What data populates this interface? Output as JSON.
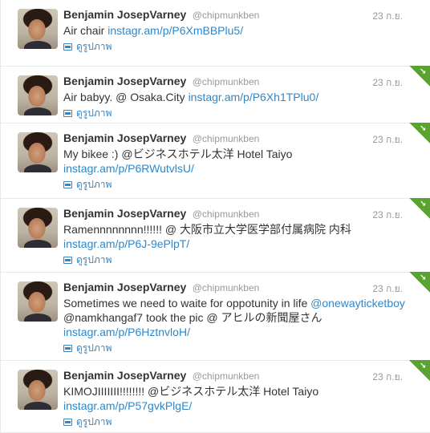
{
  "author": {
    "name": "Benjamin JosepVarney",
    "handle": "@chipmunkben"
  },
  "tweets": [
    {
      "date": "23 ก.ย.",
      "text_before": "Air chair ",
      "link1": "instagr.am/p/P6XmBBPlu5/",
      "text_after": "",
      "link2": "",
      "text_end": "",
      "view_label": "ดูรูปภาพ",
      "new": false
    },
    {
      "date": "23 ก.ย.",
      "text_before": "Air babyy. @ Osaka.City ",
      "link1": "instagr.am/p/P6Xh1TPlu0/",
      "text_after": "",
      "link2": "",
      "text_end": "",
      "view_label": "ดูรูปภาพ",
      "new": true
    },
    {
      "date": "23 ก.ย.",
      "text_before": "My bikee :) @ビジネスホテル太洋 Hotel Taiyo ",
      "link1": "instagr.am/p/P6RWutvlsU/",
      "text_after": "",
      "link2": "",
      "text_end": "",
      "view_label": "ดูรูปภาพ",
      "new": true
    },
    {
      "date": "23 ก.ย.",
      "text_before": "Ramennnnnnnn!!!!!! @ 大阪市立大学医学部付属病院 内科 ",
      "link1": "instagr.am/p/P6J-9ePlpT/",
      "text_after": "",
      "link2": "",
      "text_end": "",
      "view_label": "ดูรูปภาพ",
      "new": true
    },
    {
      "date": "23 ก.ย.",
      "text_before": "Sometimes we need to waite for oppotunity in life ",
      "link1": "@onewayticketboy",
      "text_after": " @namkhangaf7 took the pic @ アヒルの新聞屋さん ",
      "link2": "instagr.am/p/P6HztnvloH/",
      "text_end": "",
      "view_label": "ดูรูปภาพ",
      "new": true
    },
    {
      "date": "23 ก.ย.",
      "text_before": "KIMOJIIIIIII!!!!!!!! @ビジネスホテル太洋 Hotel Taiyo ",
      "link1": "instagr.am/p/P57gvkPlgE/",
      "text_after": "",
      "link2": "",
      "text_end": "",
      "view_label": "ดูรูปภาพ",
      "new": true
    }
  ],
  "colors": {
    "link": "#2f87c8",
    "new_corner": "#5aa331",
    "meta": "#999999"
  }
}
